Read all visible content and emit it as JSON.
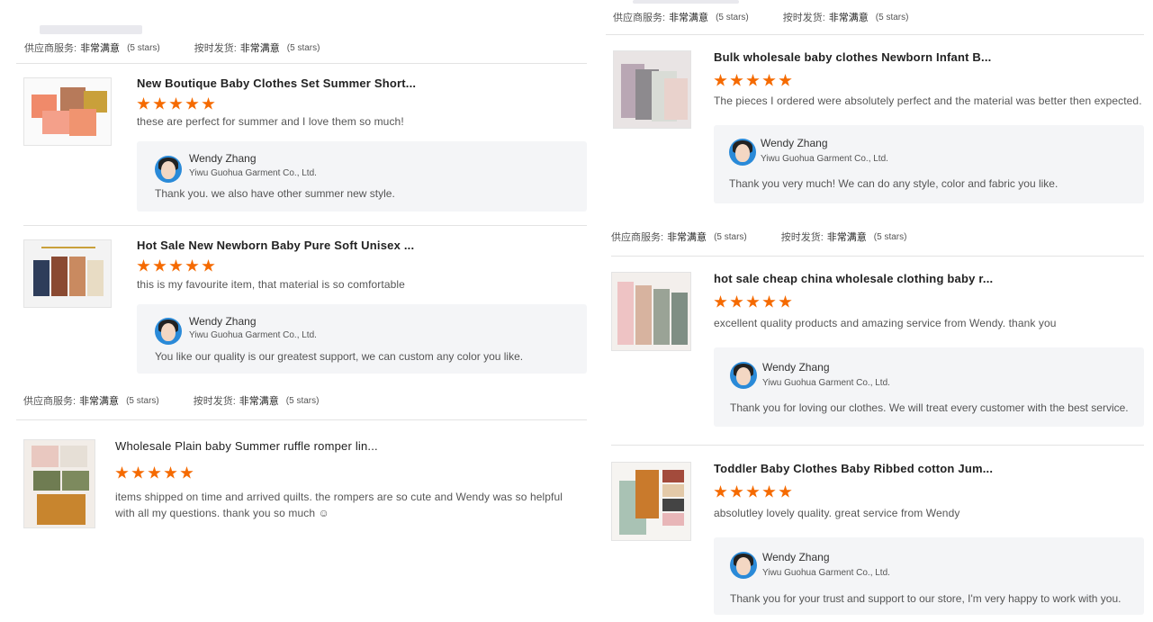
{
  "ratings": {
    "supplier_service_label": "供应商服务:",
    "supplier_service_value": "非常满意",
    "on_time_label": "按时发货:",
    "on_time_value": "非常满意",
    "stars_text": "(5 stars)"
  },
  "seller": {
    "name": "Wendy Zhang",
    "company": "Yiwu Guohua Garment Co., Ltd."
  },
  "left_reviews": [
    {
      "title": "New Boutique Baby Clothes Set Summer Short...",
      "stars": 5,
      "comment": "these are perfect for summer and I love them so much!",
      "reply": "Thank you. we also have other summer new style."
    },
    {
      "title": "Hot Sale New Newborn Baby Pure Soft Unisex ...",
      "stars": 5,
      "comment": "this is my favourite item, that material is so comfortable",
      "reply": "You like our quality is our greatest support, we can custom any color you like."
    },
    {
      "title": "Wholesale Plain baby Summer ruffle romper lin...",
      "stars": 5,
      "comment": "items shipped on time and arrived quilts. the rompers are so cute and Wendy was so helpful with all my questions. thank you so much ☺"
    }
  ],
  "right_reviews": [
    {
      "title": "Bulk wholesale baby clothes Newborn Infant B...",
      "stars": 5,
      "comment": "The pieces I ordered were absolutely perfect and the material was better then expected.",
      "reply": "Thank you very much! We can do any style, color and fabric you like."
    },
    {
      "title": "hot sale cheap china wholesale clothing baby r...",
      "stars": 5,
      "comment": "excellent quality products and amazing service from Wendy. thank you",
      "reply": "Thank you for loving our clothes. We will treat every customer with the best service."
    },
    {
      "title": "Toddler Baby Clothes Baby Ribbed cotton Jum...",
      "stars": 5,
      "comment": "absolutley lovely quality. great service from Wendy",
      "reply": "Thank you for your trust and support to our store, I'm very happy to work with you."
    }
  ],
  "colors": {
    "star": "#f56a00",
    "reply_bg": "#f4f5f7",
    "avatar_bg": "#2a8ad8"
  }
}
